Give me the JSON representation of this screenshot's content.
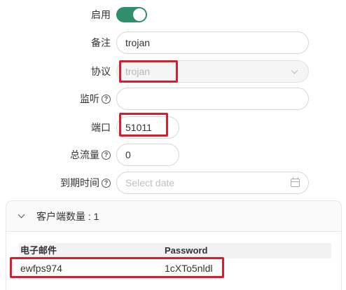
{
  "form": {
    "enable": {
      "label": "启用",
      "checked": true
    },
    "remark": {
      "label": "备注",
      "value": "trojan"
    },
    "protocol": {
      "label": "协议",
      "value": "trojan"
    },
    "listen": {
      "label": "监听",
      "help_icon": "question-circle-icon",
      "value": ""
    },
    "port": {
      "label": "端口",
      "value": "51011"
    },
    "total_traffic": {
      "label": "总流量",
      "help_icon": "question-circle-icon",
      "value": "0"
    },
    "expiry": {
      "label": "到期时间",
      "help_icon": "question-circle-icon",
      "placeholder": "Select date",
      "icon": "calendar-icon"
    }
  },
  "clients_panel": {
    "title": "客户端数量 : 1",
    "icon": "chevron-down-icon",
    "columns": [
      "电子邮件",
      "Password"
    ],
    "rows": [
      {
        "email": "ewfps974",
        "password": "1cXTo5nldl"
      }
    ]
  },
  "colors": {
    "toggle_on": "#2f8f6a",
    "highlight_box": "#d4202c"
  }
}
